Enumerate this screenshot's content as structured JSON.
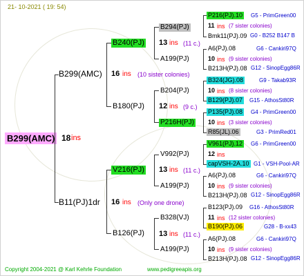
{
  "header": {
    "date": "21- 10-2021 ( 19: 54)"
  },
  "footer": {
    "copyright": "Copyright 2004-2021 @ Karl Kehrle Foundation",
    "website": "www.pedigreeapis.org"
  },
  "colors": {
    "root_box": "#ffaaff",
    "green_box": "#22dd22",
    "gray_box": "#c0c0c0",
    "cyan_box": "#22dddd",
    "yellow_box": "#ffee00",
    "ins_text": "#ff0000",
    "info_text": "#0000cc",
    "colonies_text": "#8800cc",
    "header_text": "#888800",
    "footer_text": "#00aa00"
  },
  "root": {
    "name": "B299(AMC)",
    "num": "18",
    "ins": "ins"
  },
  "gen1": [
    {
      "name": "B299(AMC)",
      "num": "16",
      "ins": "ins",
      "note": "(10 sister colonies)"
    },
    {
      "name": "B11(PJ)1dr",
      "num": "16",
      "ins": "ins",
      "note": "(Only one drone)"
    }
  ],
  "gen2": [
    {
      "name": "B240(PJ)",
      "num": "13",
      "ins": "ins",
      "note": "(11 c.)"
    },
    {
      "name": "B180(PJ)",
      "num": "12",
      "ins": "ins",
      "note": "(9 c.)"
    },
    {
      "name": "V216(PJ)",
      "num": "13",
      "ins": "ins",
      "note": "(11 c.)"
    },
    {
      "name": "B126(PJ)",
      "num": "13",
      "ins": "ins",
      "note": "(11 c.)"
    }
  ],
  "gen3": [
    {
      "name": "B294(PJ)"
    },
    {
      "name": "A199(PJ)"
    },
    {
      "name": "B204(PJ)"
    },
    {
      "name": "P216H(PJ)"
    },
    {
      "name": "V992(PJ)"
    },
    {
      "name": "A199(PJ)"
    },
    {
      "name": "B328(VJ)"
    },
    {
      "name": "A199(PJ)"
    }
  ],
  "gen4": [
    {
      "top": "P216(PJ).10",
      "top_info": "G5 - PrimGreen00",
      "num": "11",
      "ins": "ins",
      "note": "(7 sister colonies)",
      "bot": "Bmk11(PJ).09",
      "bot_info": "G0 - B252 B147 B"
    },
    {
      "top": "A6(PJ).08",
      "top_info": "G6 - Cankiri97Q",
      "num": "10",
      "ins": "ins",
      "note": "(9 sister colonies)",
      "bot": "B213H(PJ).08",
      "bot_info": "G12 - SinopEgg86R"
    },
    {
      "top": "B324(JG).08",
      "top_info": "G9 - Takab93R",
      "num": "10",
      "ins": "ins",
      "note": "(8 sister colonies)",
      "bot": "B129(PJ).07",
      "bot_info": "G15 - AthosSt80R"
    },
    {
      "top": "P135(PJ).08",
      "top_info": "G4 - PrimGreen00",
      "num": "10",
      "ins": "ins",
      "note": "(3 sister colonies)",
      "bot": "R85(JL).06",
      "bot_info": "G3 - PrimRed01"
    },
    {
      "top": "V961(PJ).12",
      "top_info": "G6 - PrimGreen00",
      "num": "12",
      "ins": "ins",
      "note": "",
      "bot": "capVSH-2A.10",
      "bot_info": "G1 - VSH-Pool-AR"
    },
    {
      "top": "A6(PJ).08",
      "top_info": "G6 - Cankiri97Q",
      "num": "10",
      "ins": "ins",
      "note": "(9 sister colonies)",
      "bot": "B213H(PJ).08",
      "bot_info": "G12 - SinopEgg86R"
    },
    {
      "top": "B123(PJ).09",
      "top_info": "G16 - AthosSt80R",
      "num": "11",
      "ins": "ins",
      "note": "(12 sister colonies)",
      "bot": "B190(PJ).06",
      "bot_info": "G28 - B-xx43"
    },
    {
      "top": "A6(PJ).08",
      "top_info": "G6 - Cankiri97Q",
      "num": "10",
      "ins": "ins",
      "note": "(9 sister colonies)",
      "bot": "B213H(PJ).08",
      "bot_info": "G12 - SinopEgg86R"
    }
  ]
}
